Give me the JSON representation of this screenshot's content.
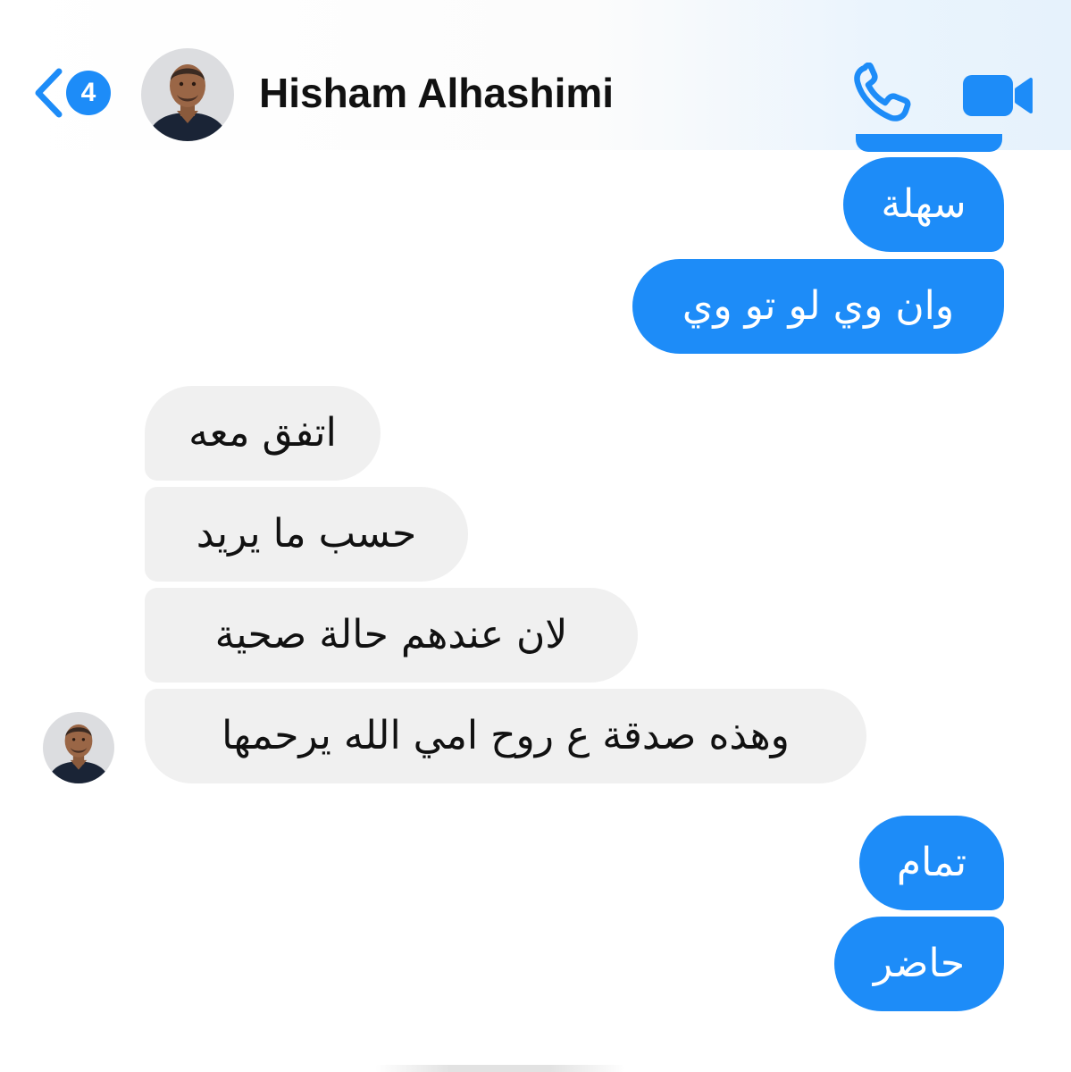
{
  "header": {
    "unread_count": "4",
    "contact_name": "Hisham Alhashimi",
    "back_icon": "chevron-left-icon",
    "call_icon": "phone-icon",
    "video_icon": "video-camera-icon"
  },
  "messages": [
    {
      "text": "سهلة",
      "sender": "me"
    },
    {
      "text": "وان وي لو تو وي",
      "sender": "me"
    },
    {
      "text": "اتفق معه",
      "sender": "contact"
    },
    {
      "text": "حسب ما يريد",
      "sender": "contact"
    },
    {
      "text": "لان عندهم حالة صحية",
      "sender": "contact"
    },
    {
      "text": "وهذه صدقة ع روح امي الله يرحمها",
      "sender": "contact"
    },
    {
      "text": "تمام",
      "sender": "me"
    },
    {
      "text": "حاضر",
      "sender": "me"
    }
  ],
  "colors": {
    "accent": "#1d8cf8",
    "sent_bubble": "#1d8cf8",
    "received_bubble": "#f0f0f0",
    "text": "#111111"
  }
}
